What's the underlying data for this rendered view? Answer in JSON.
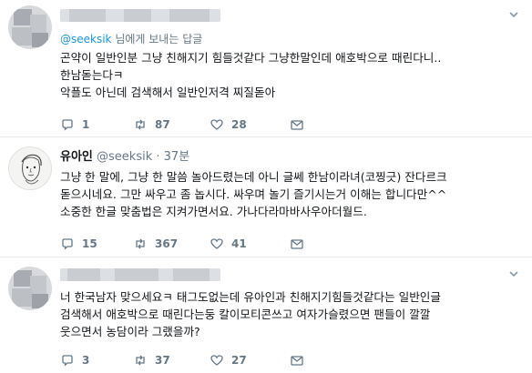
{
  "tweets": [
    {
      "reply_to": {
        "handle": "@seeksik",
        "suffix": " 님에게 보내는 답글"
      },
      "text": "곤약이 일반인분 그냥 친해지기 힘들것같다 그냥한말인데 애호박으로 때린다니..\n한남돋는다ㅋ\n악플도 아닌데 검색해서 일반인저격 찌질돋아",
      "actions": {
        "replies": "1",
        "retweets": "87",
        "likes": "28"
      }
    },
    {
      "display_name": "유아인",
      "handle": "@seeksik",
      "time": "· 37분",
      "text": "그냥 한 말에, 그냥 한 말씀 놀아드렸는데 아니 글쎄 한남이라녀(코찡긋) 잔다르크\n돋으시네요. 그만 싸우고 좀 놉시다. 싸우며 놀기 즐기시는거 이해는 합니다만^^\n소중한 한글 맞춤법은 지켜가면서요. 가나다라마바사우아더월드.",
      "actions": {
        "replies": "15",
        "retweets": "367",
        "likes": "41"
      }
    },
    {
      "text": "너 한국남자 맞으세요ㅋ 태그도없는데 유아인과 친해지기힘들것같다는 일반인글\n검색해서 애호박으로 때린다는둥 칼이모티콘쓰고 여자가슬렸으면 팬들이 깔깔\n웃으면서 농담이라 그랬을까?",
      "actions": {
        "replies": "3",
        "retweets": "37",
        "likes": "27"
      }
    }
  ],
  "colors": {
    "link": "#1b95e0",
    "muted": "#657786",
    "text": "#14171a",
    "border": "#e6ecf0"
  }
}
